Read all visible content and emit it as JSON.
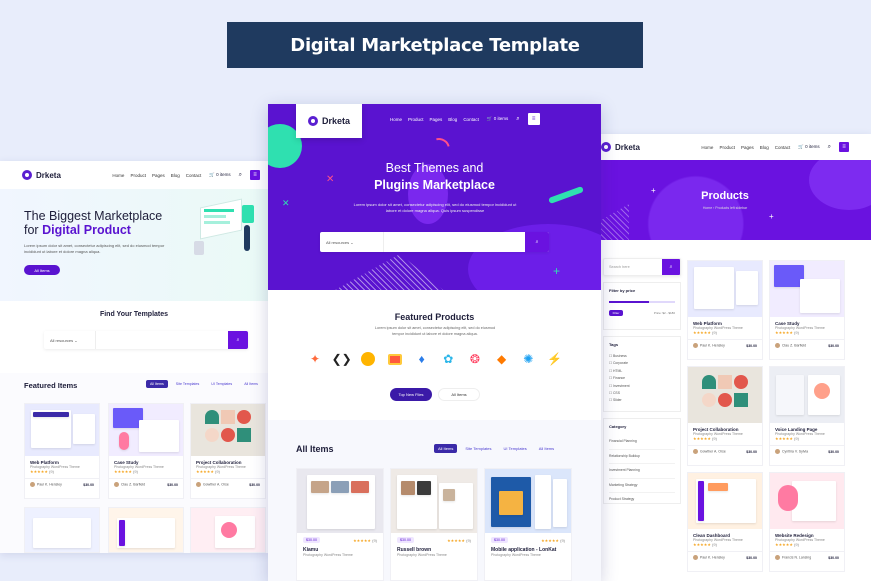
{
  "banner_title": "Digital Marketplace Template",
  "brand": "Drketa",
  "nav": {
    "home": "Home",
    "product": "Product",
    "pages": "Pages",
    "blog": "Blog",
    "contact": "Contact",
    "cart": "0 items"
  },
  "left": {
    "hero_line1": "The Biggest Marketplace",
    "hero_for": "for",
    "hero_highlight": "Digital Product",
    "hero_desc": "Lorem ipsum dolor sit amet, consectetur adipiscing elit, sed do eiusmod tempor incididunt ut labore et dolore magna aliqua.",
    "hero_button": "All Items",
    "find_title": "Find Your Templates",
    "select_value": "All resources",
    "featured_title": "Featured Items",
    "tabs": [
      "All Items",
      "Site Templates",
      "UI Templates",
      "All Items"
    ],
    "cards": [
      {
        "title": "Web Platform",
        "sub": "Photography WordPress Theme",
        "rating": "(9)",
        "author": "Paul K. Hensley",
        "price": "$30.00"
      },
      {
        "title": "Case Study",
        "sub": "Photography WordPress Theme",
        "rating": "(9)",
        "author": "Clau Z. Barfield",
        "price": "$30.00"
      },
      {
        "title": "Project Collaboration",
        "sub": "Photography WordPress Theme",
        "rating": "(9)",
        "author": "Gowther A. Orse",
        "price": "$30.00"
      }
    ]
  },
  "center": {
    "hero_line1": "Best Themes and",
    "hero_line2": "Plugins Marketplace",
    "hero_desc": "Lorem ipsum dolor sit amet, consectetur adipiscing elit, sed do eiusmod tempor incididunt ut labore et dolore magna aliqua. Quis ipsum suspendisse",
    "select_value": "All resources",
    "featured_title": "Featured Products",
    "featured_desc": "Lorem ipsum dolor sit amet, consectetur adipiscing elit, sed do eiusmod tempor incididunt ut labore et dolore magna aliqua.",
    "btn_new": "Top New Files",
    "btn_all": "All Items",
    "all_items_title": "All Items",
    "tabs": [
      "All Items",
      "Site Templates",
      "UI Templates",
      "All Items"
    ],
    "cards": [
      {
        "price": "$30.00",
        "rating": "(9)",
        "title": "Kiamu",
        "sub": "Photography WordPress Theme"
      },
      {
        "price": "$30.00",
        "rating": "(9)",
        "title": "Russell brown",
        "sub": "Photography WordPress Theme"
      },
      {
        "price": "$30.00",
        "rating": "(9)",
        "title": "Mobile application - LonKat",
        "sub": "Photography WordPress Theme"
      }
    ]
  },
  "right": {
    "page_title": "Products",
    "breadcrumb": "Home › Products left sidebar",
    "search_placeholder": "Search here",
    "filter_title": "Filter by price",
    "filter_btn": "Filter",
    "price_range": "Price: $2 - $180",
    "tags_title": "Tags",
    "tags": [
      "Business",
      "Corporate",
      "HTML",
      "Finance",
      "Investment",
      "CSS",
      "Slider"
    ],
    "category_title": "Category",
    "categories": [
      "Financial Planning",
      "Relationship Buildup",
      "Investment Planning",
      "Marketing Strategy",
      "Product Strategy"
    ],
    "cards": [
      {
        "title": "Web Platform",
        "sub": "Photography WordPress Theme",
        "rating": "(9)",
        "author": "Paul K. Hensley",
        "price": "$30.00"
      },
      {
        "title": "Case Study",
        "sub": "Photography WordPress Theme",
        "rating": "(9)",
        "author": "Clau Z. Barfield",
        "price": "$30.00"
      },
      {
        "title": "Project Collaboration",
        "sub": "Photography WordPress Theme",
        "rating": "(9)",
        "author": "Gowther A. Orse",
        "price": "$30.00"
      },
      {
        "title": "Voice Landing Page",
        "sub": "Photography WordPress Theme",
        "rating": "(9)",
        "author": "Cynthia V. Sylvia",
        "price": "$30.00"
      },
      {
        "title": "Clean Dashboard",
        "sub": "Photography WordPress Theme",
        "rating": "(9)",
        "author": "Paul K. Hensley",
        "price": "$30.00"
      },
      {
        "title": "Website Redesign",
        "sub": "Photography WordPress Theme",
        "rating": "(9)",
        "author": "Francis N. Lansing",
        "price": "$30.00"
      }
    ]
  },
  "colors": {
    "purple": "#5a13d0",
    "violet": "#6a12e0",
    "banner": "#1f3a5f",
    "teal": "#2fe0b0",
    "pink": "#ff4f8a",
    "star": "#f5a623"
  }
}
